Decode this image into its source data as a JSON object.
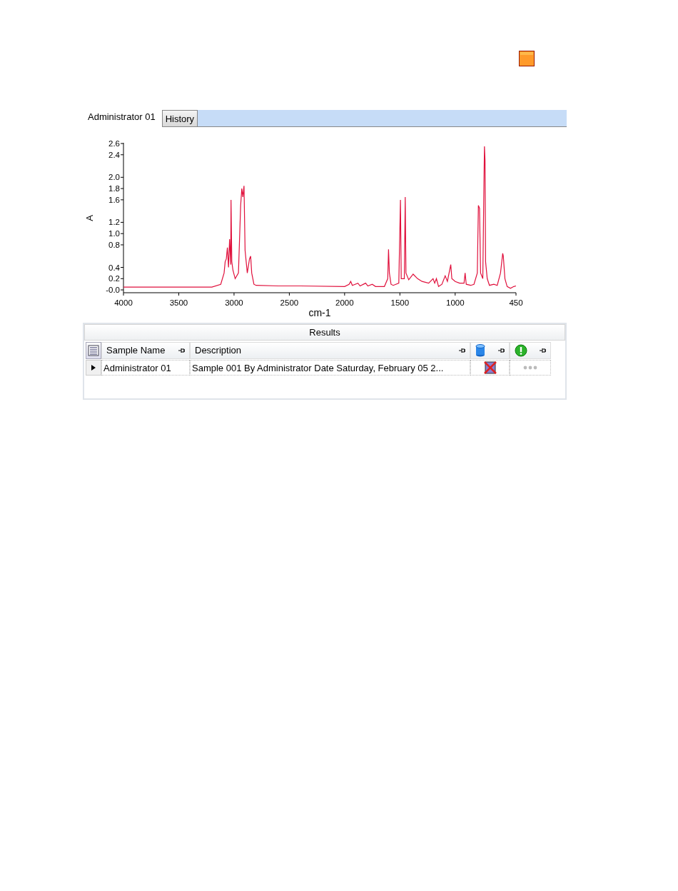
{
  "tabs": [
    {
      "label": "Administrator 01",
      "selected": true
    },
    {
      "label": "History",
      "selected": false
    }
  ],
  "chart_data": {
    "type": "line",
    "xlabel": "cm-1",
    "ylabel": "A",
    "xlim": [
      4000,
      450
    ],
    "ylim": [
      -0.05,
      2.6
    ],
    "xticks": [
      4000,
      3500,
      3000,
      2500,
      2000,
      1500,
      1000,
      450
    ],
    "yticks": [
      {
        "value": 0,
        "label": "-0.0"
      },
      0.2,
      0.4,
      0.8,
      {
        "value": 1,
        "label": "1.0"
      },
      1.2,
      1.6,
      1.8,
      {
        "value": 2,
        "label": "2.0"
      },
      2.4,
      2.6
    ],
    "x": [
      4000,
      3200,
      3120,
      3090,
      3080,
      3070,
      3060,
      3050,
      3040,
      3030,
      3027,
      3020,
      3010,
      2990,
      2960,
      2940,
      2930,
      2920,
      2910,
      2900,
      2880,
      2860,
      2850,
      2840,
      2820,
      2800,
      2600,
      2400,
      2000,
      1960,
      1945,
      1930,
      1880,
      1860,
      1810,
      1790,
      1750,
      1720,
      1640,
      1610,
      1603,
      1595,
      1580,
      1560,
      1510,
      1495,
      1488,
      1460,
      1452,
      1445,
      1420,
      1380,
      1340,
      1300,
      1240,
      1200,
      1185,
      1170,
      1150,
      1120,
      1090,
      1070,
      1040,
      1030,
      1000,
      960,
      920,
      910,
      900,
      860,
      830,
      800,
      790,
      780,
      770,
      750,
      740,
      735,
      730,
      725,
      710,
      690,
      650,
      620,
      590,
      570,
      565,
      550,
      530,
      500,
      470,
      450
    ],
    "series": [
      {
        "color": "#e0103c",
        "values": [
          0.05,
          0.05,
          0.1,
          0.3,
          0.5,
          0.55,
          0.75,
          0.4,
          0.9,
          0.45,
          1.6,
          0.5,
          0.35,
          0.2,
          0.3,
          1.5,
          1.8,
          1.65,
          1.85,
          0.7,
          0.3,
          0.55,
          0.6,
          0.3,
          0.1,
          0.08,
          0.07,
          0.07,
          0.06,
          0.1,
          0.15,
          0.08,
          0.12,
          0.07,
          0.12,
          0.07,
          0.1,
          0.06,
          0.06,
          0.2,
          0.72,
          0.3,
          0.1,
          0.08,
          0.12,
          1.6,
          0.2,
          0.2,
          1.65,
          0.3,
          0.18,
          0.28,
          0.2,
          0.15,
          0.12,
          0.2,
          0.12,
          0.2,
          0.06,
          0.1,
          0.25,
          0.15,
          0.45,
          0.2,
          0.15,
          0.12,
          0.12,
          0.3,
          0.1,
          0.08,
          0.1,
          0.3,
          1.5,
          1.45,
          0.3,
          0.2,
          1.9,
          2.55,
          2.3,
          0.5,
          0.2,
          0.08,
          0.1,
          0.08,
          0.3,
          0.65,
          0.6,
          0.2,
          0.06,
          0.03,
          0.06,
          0.07
        ]
      }
    ]
  },
  "results": {
    "title": "Results",
    "columns": [
      {
        "kind": "text",
        "label": "Sample Name"
      },
      {
        "kind": "text",
        "label": "Description"
      },
      {
        "kind": "database"
      },
      {
        "kind": "status"
      }
    ],
    "rows": [
      {
        "current": true,
        "cells": [
          {
            "kind": "text",
            "text": "Administrator 01"
          },
          {
            "kind": "text",
            "text": "Sample 001 By Administrator Date Saturday, February 05 2..."
          },
          {
            "kind": "database-missing"
          },
          {
            "kind": "status-pending"
          }
        ]
      }
    ]
  }
}
